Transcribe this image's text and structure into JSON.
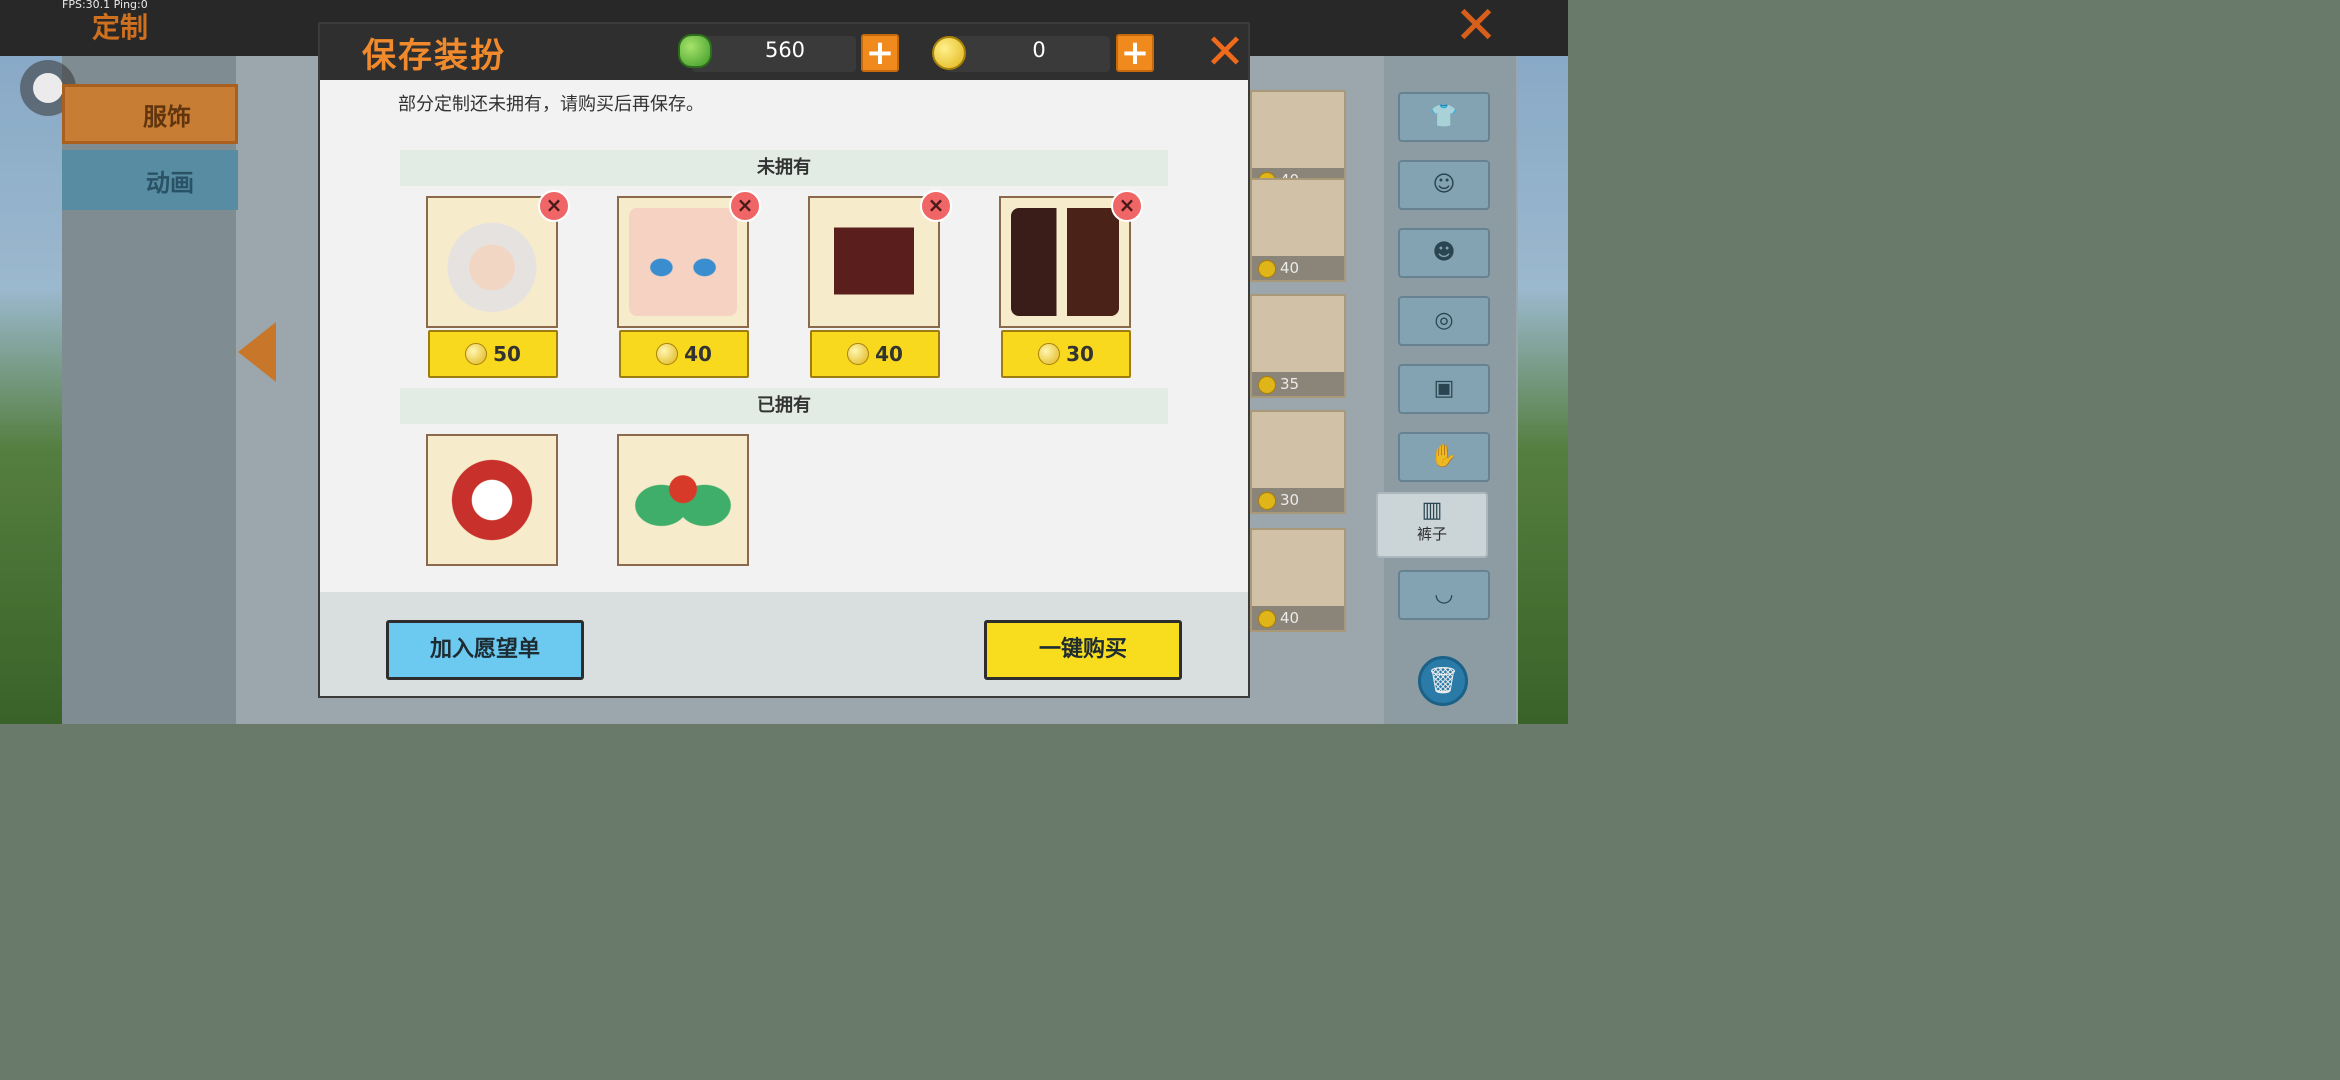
{
  "hud": {
    "fps_text": "FPS:30.1  Ping:0"
  },
  "background": {
    "title": "定制",
    "side_tabs": [
      {
        "label": "服饰"
      },
      {
        "label": "动画"
      }
    ],
    "right_list_prices": [
      "40",
      "40",
      "35",
      "30",
      "40"
    ],
    "active_category_label": "裤子"
  },
  "dialog": {
    "title": "保存装扮",
    "currency": {
      "gems": "560",
      "coins": "0"
    },
    "notice": "部分定制还未拥有，请购买后再保存。",
    "unowned_header": "未拥有",
    "owned_header": "已拥有",
    "unowned_items": [
      {
        "name": "bunny-ear-hair",
        "price": "50"
      },
      {
        "name": "shy-face",
        "price": "40"
      },
      {
        "name": "red-shorts",
        "price": "40"
      },
      {
        "name": "dark-boots",
        "price": "30"
      }
    ],
    "owned_items": [
      {
        "name": "red-jacket"
      },
      {
        "name": "green-gift-bow"
      }
    ],
    "remove_glyph": "×",
    "wishlist_label": "加入愿望单",
    "buy_all_label": "一键购买"
  },
  "colors": {
    "accent": "#f08a2c",
    "buy": "#f8dc1e",
    "wishlist": "#6cc9f0",
    "remove": "#f06666"
  }
}
